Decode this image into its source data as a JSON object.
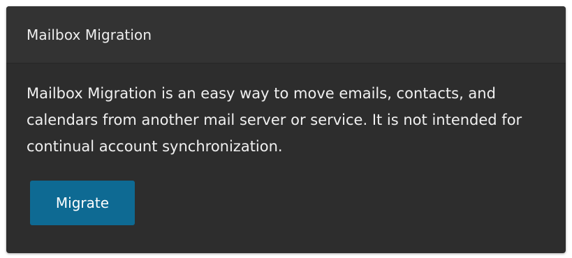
{
  "panel": {
    "title": "Mailbox Migration",
    "description": "Mailbox Migration is an easy way to move emails, contacts, and calendars from another mail server or service. It is not intended for continual account synchronization.",
    "migrate_label": "Migrate"
  },
  "colors": {
    "panel_background": "#2d2d2d",
    "header_background": "#333333",
    "button_background": "#0e6a93",
    "text": "#f0f0f0"
  }
}
